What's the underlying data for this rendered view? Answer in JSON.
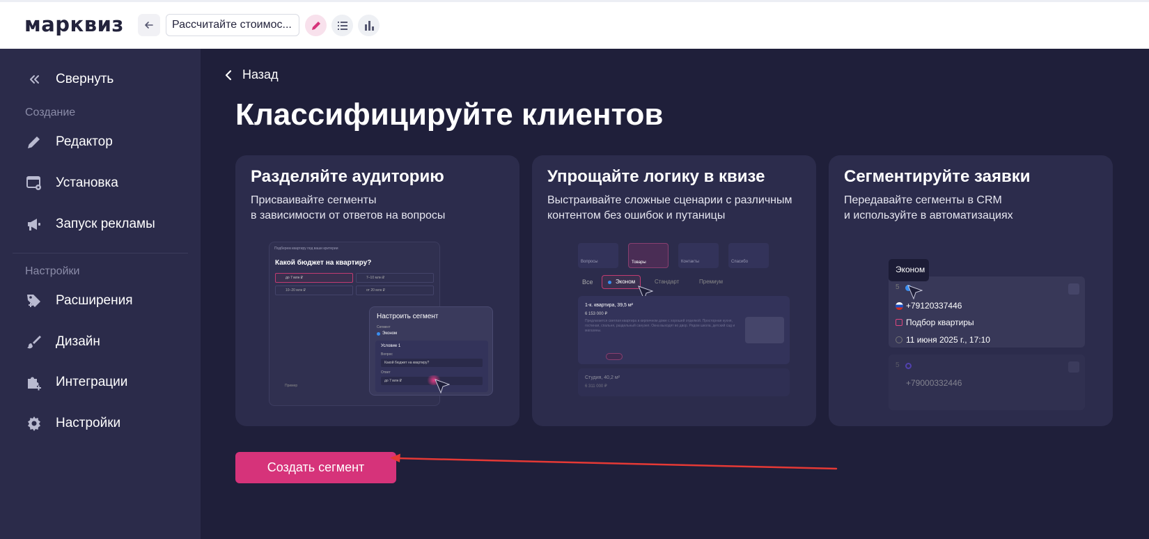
{
  "header": {
    "logo": "марквиз",
    "quiz_title": "Рассчитайте стоимос...",
    "icons": [
      "arrow-left-icon",
      "pencil-icon",
      "list-icon",
      "bar-chart-icon"
    ]
  },
  "sidebar": {
    "collapse": "Свернуть",
    "section_create": "Создание",
    "items_create": [
      "Редактор",
      "Установка",
      "Запуск рекламы"
    ],
    "section_settings": "Настройки",
    "items_settings": [
      "Расширения",
      "Дизайн",
      "Интеграции",
      "Настройки"
    ]
  },
  "main": {
    "back": "Назад",
    "title": "Классифицируйте клиентов",
    "cta": "Создать сегмент"
  },
  "cards": [
    {
      "title": "Разделяйте аудиторию",
      "desc": "Присваивайте сегменты\nв зависимости от ответов на вопросы",
      "mock": {
        "header": "Подберем квартиру под ваши критерии",
        "question": "Какой бюджет на квартиру?",
        "options": [
          "до 7 млн ₽",
          "7–10 млн ₽",
          "10–20 млн ₽",
          "от 20 млн ₽"
        ],
        "panel_title": "Настроить сегмент",
        "segment_label": "Сегмент",
        "segment_value": "Эконом",
        "condition_label": "Условие 1",
        "question_label": "Вопрос",
        "question_value": "Какой бюджет на квартиру?",
        "answer_label": "Ответ",
        "answer_value": "до 7 млн ₽",
        "footer_label": "Пример"
      }
    },
    {
      "title": "Упрощайте логику в квизе",
      "desc": "Выстраивайте сложные сценарии с различным\nконтентом без ошибок и путаницы",
      "mock": {
        "steps": [
          "Вопросы",
          "Товары",
          "Контакты",
          "Спасибо"
        ],
        "filters": [
          "Все",
          "Эконом",
          "Стандарт",
          "Премиум"
        ],
        "product_title": "1-к. квартира, 39,5 м²",
        "product_price": "6 153 000 ₽",
        "product_desc": "Предлагается светлая квартира в кирпичном доме с хорошей отделкой. Просторная кухня, гостиная, спальня, раздельный санузел. Окна выходят во двор. Рядом школа, детский сад и магазины.",
        "product2_title": "Студия, 40,2 м²",
        "product2_price": "6 311 000 ₽"
      }
    },
    {
      "title": "Сегментируйте заявки",
      "desc": "Передавайте сегменты в CRM\nи используйте в автоматизациях",
      "mock": {
        "tooltip": "Эконом",
        "lead1_num": "5",
        "lead1_phone": "+79120337446",
        "lead1_tag": "Подбор квартиры",
        "lead1_date": "11 июня 2025 г., 17:10",
        "lead2_num": "5",
        "lead2_phone": "+79000332446"
      }
    }
  ],
  "colors": {
    "accent": "#d6337a",
    "sidebar_bg": "#2b2b4a",
    "main_bg": "#1f1f3a",
    "card_bg": "#2c2c4c",
    "annotation_arrow": "#e53935"
  }
}
